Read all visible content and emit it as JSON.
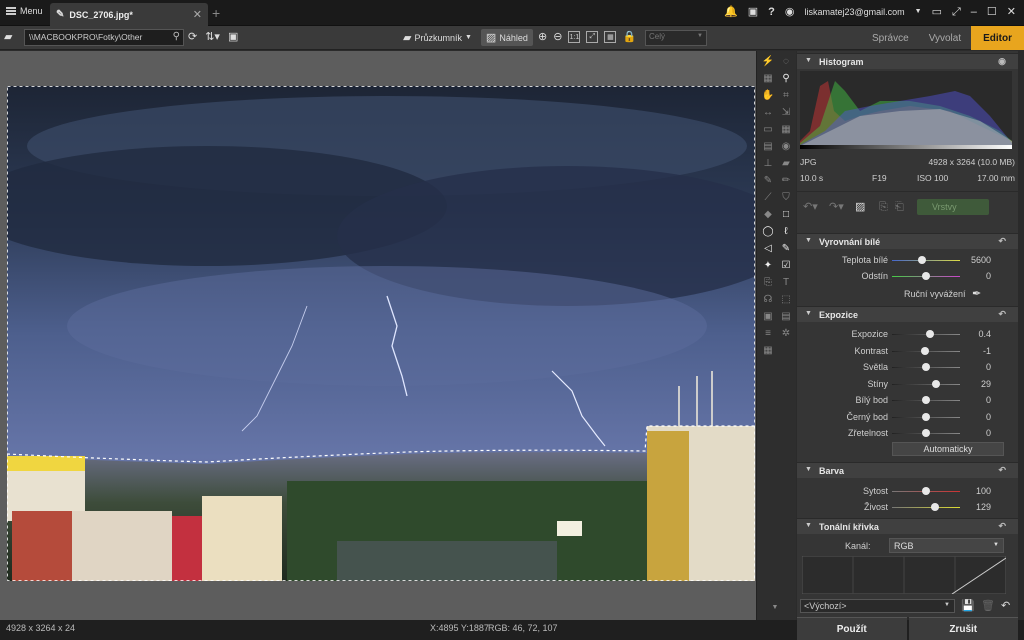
{
  "titlebar": {
    "menu_label": "Menu",
    "tab_title": "DSC_2706.jpg*",
    "user_email": "liskamatej23@gmail.com"
  },
  "toolbar": {
    "path": "\\\\MACBOOKPRO\\Fotky\\Other",
    "browser_label": "Průzkumník",
    "preview_label": "Náhled",
    "zoom_fit": "1:1",
    "zoom_select_value": "Celý"
  },
  "modes": {
    "manager": "Správce",
    "develop": "Vyvolat",
    "editor": "Editor"
  },
  "histogram": {
    "title": "Histogram",
    "format": "JPG",
    "dimensions": "4928 x 3264 (10.0 MB)",
    "shutter": "10.0 s",
    "aperture": "F19",
    "iso": "ISO 100",
    "focal": "17.00 mm"
  },
  "history": {
    "history_label": "Vrstvy"
  },
  "white_balance": {
    "title": "Vyrovnání bílé",
    "temp_label": "Teplota bílé",
    "temp_value": "5600",
    "tint_label": "Odstín",
    "tint_value": "0",
    "manual_label": "Ruční vyvážení"
  },
  "exposure": {
    "title": "Expozice",
    "rows": [
      {
        "label": "Expozice",
        "value": "0.4",
        "pos": 0.56
      },
      {
        "label": "Kontrast",
        "value": "-1",
        "pos": 0.49
      },
      {
        "label": "Světla",
        "value": "0",
        "pos": 0.5
      },
      {
        "label": "Stíny",
        "value": "29",
        "pos": 0.64
      },
      {
        "label": "Bílý bod",
        "value": "0",
        "pos": 0.5
      },
      {
        "label": "Černý bod",
        "value": "0",
        "pos": 0.5
      },
      {
        "label": "Zřetelnost",
        "value": "0",
        "pos": 0.5
      }
    ],
    "auto_label": "Automaticky"
  },
  "color": {
    "title": "Barva",
    "saturation_label": "Sytost",
    "saturation_value": "100",
    "vibrance_label": "Živost",
    "vibrance_value": "129"
  },
  "curve": {
    "title": "Tonální křivka",
    "channel_label": "Kanál:",
    "channel_value": "RGB",
    "preset_value": "<Výchozí>"
  },
  "footer": {
    "apply": "Použít",
    "cancel": "Zrušit"
  },
  "status": {
    "image_info": "4928 x 3264 x 24",
    "cursor": "X:4895 Y:1887",
    "rgb": "RGB: 46, 72, 107"
  },
  "colors": {
    "accent": "#e8a51e",
    "panel_bg": "#353535"
  }
}
